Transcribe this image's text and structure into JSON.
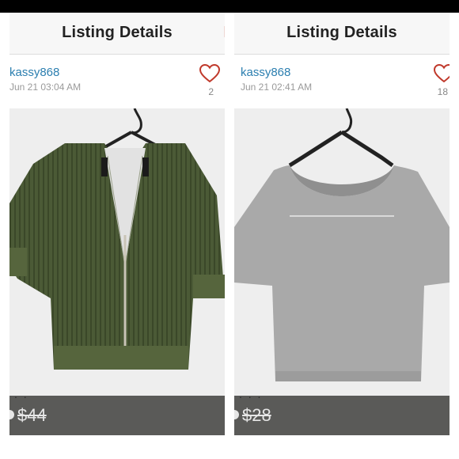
{
  "listings": [
    {
      "header_title": "Listing Details",
      "username": "kassy868",
      "timestamp": "Jun 21 03:04 AM",
      "likes": "2",
      "price": "$44",
      "item": "green-zip-cardigan"
    },
    {
      "header_title": "Listing Details",
      "username": "kassy868",
      "timestamp": "Jun 21 02:41 AM",
      "likes": "18",
      "price": "$28",
      "item": "gray-crop-tee"
    }
  ],
  "colors": {
    "accent_heart": "#c0392b",
    "username": "#2c7fb0",
    "price_bar": "#5a5a58",
    "cardigan": "#4b5a36",
    "tee": "#a9a9a9"
  },
  "icons": [
    "heart-icon",
    "hanger-icon"
  ]
}
